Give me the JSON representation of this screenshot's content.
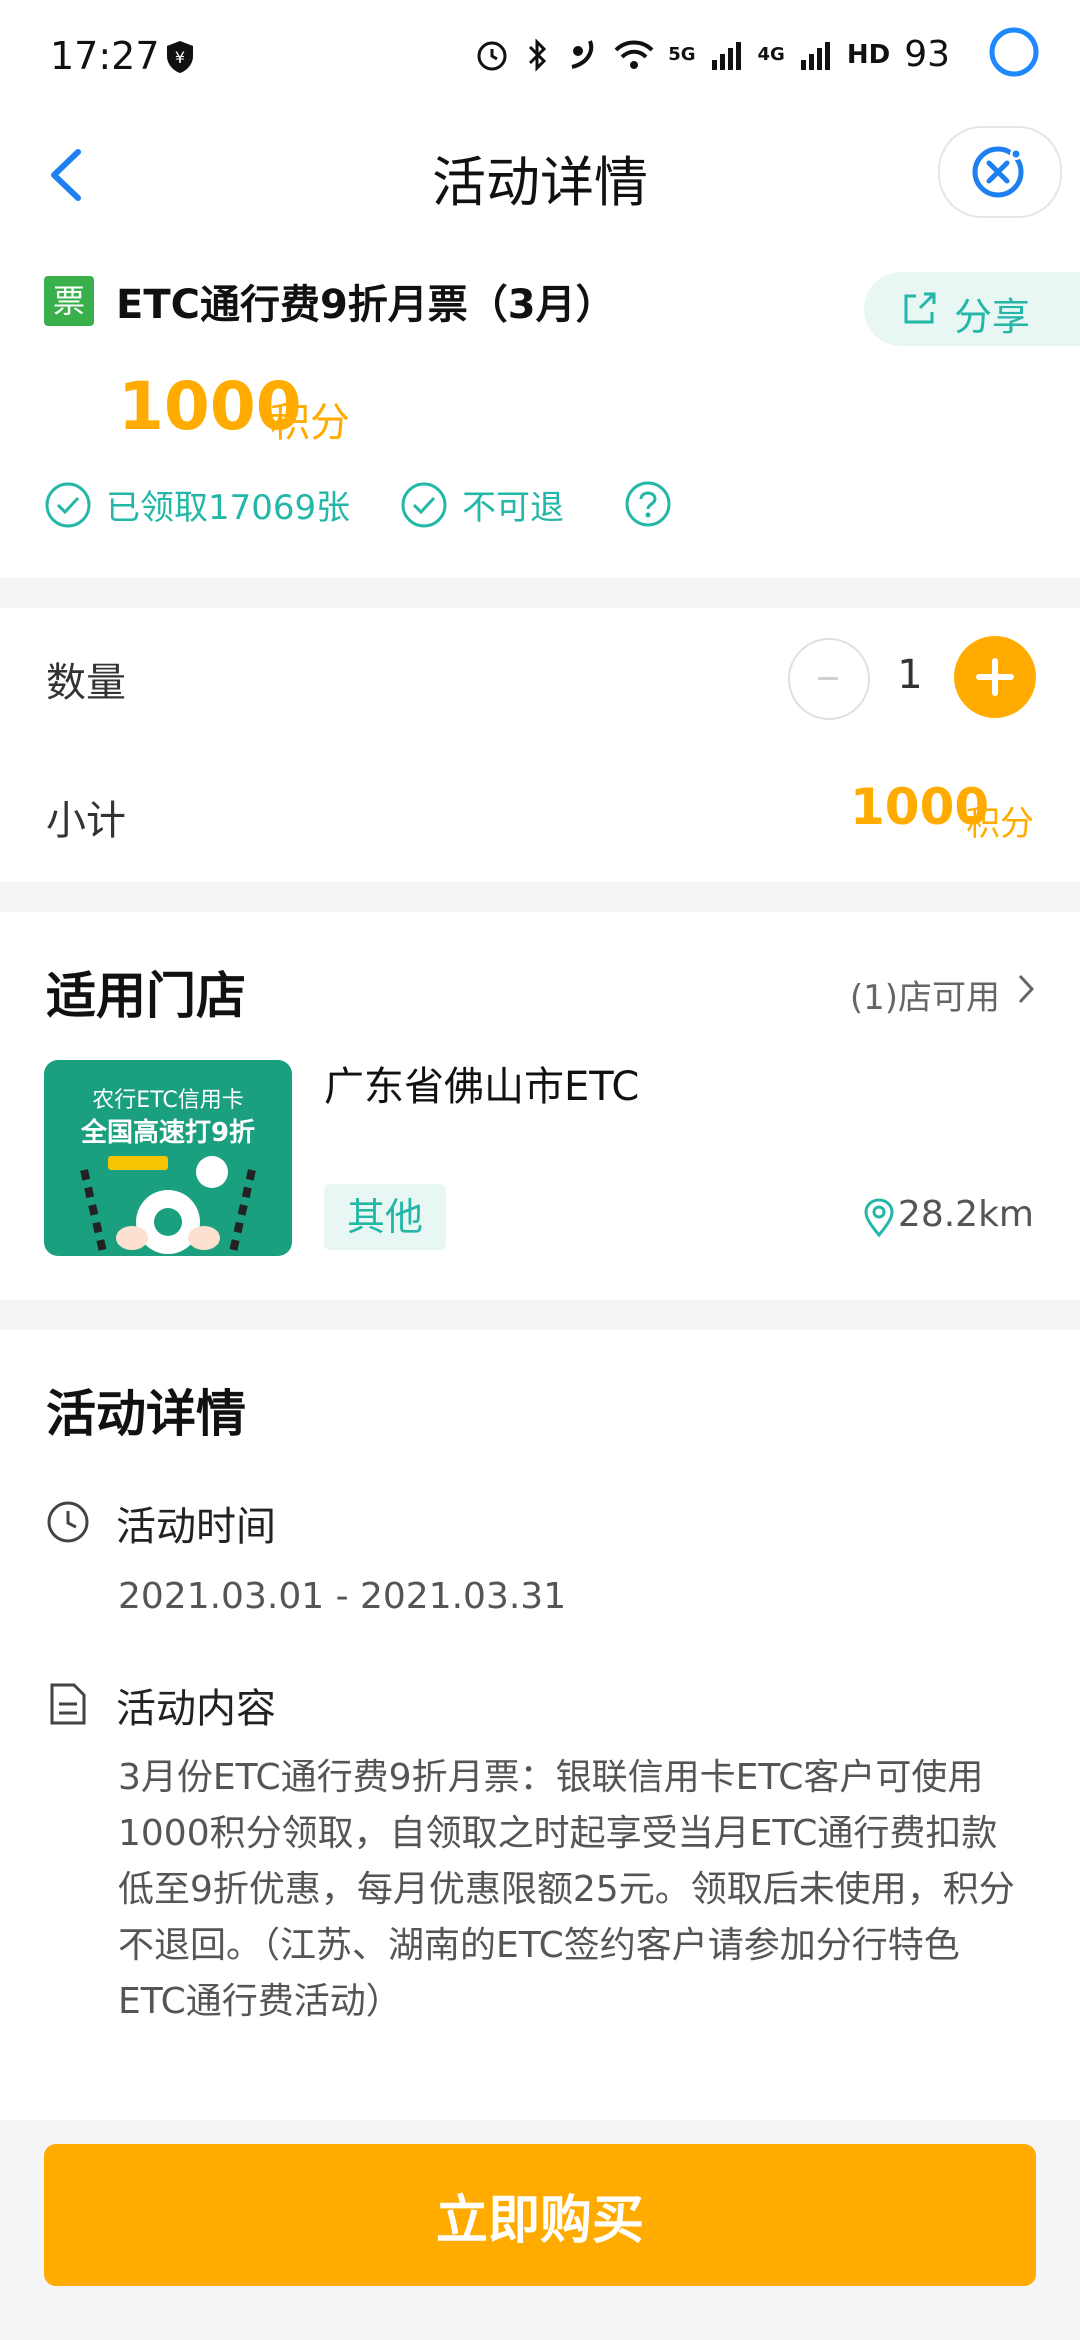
{
  "status_bar": {
    "time": "17:27",
    "battery": "93",
    "signal_5g": "5G",
    "signal_4g": "4G",
    "hd_label": "HD"
  },
  "header": {
    "title": "活动详情"
  },
  "product": {
    "badge": "票",
    "title": "ETC通行费9折月票（3月）",
    "share_label": "分享",
    "price": "1000",
    "price_unit": "积分",
    "tags": [
      "已领取17069张",
      "不可退"
    ]
  },
  "quantity": {
    "label": "数量",
    "value": "1",
    "subtotal_label": "小计",
    "subtotal_value": "1000",
    "subtotal_unit": "积分"
  },
  "stores": {
    "title": "适用门店",
    "count": "(1)店可用",
    "store": {
      "image_line1": "农行ETC信用卡",
      "image_line2": "全国高速打9折",
      "name": "广东省佛山市ETC",
      "tag": "其他",
      "distance": "28.2km"
    }
  },
  "details": {
    "title": "活动详情",
    "time_label": "活动时间",
    "time_value": "2021.03.01 - 2021.03.31",
    "content_label": "活动内容",
    "content_value": "3月份ETC通行费9折月票：银联信用卡ETC客户可使用1000积分领取，自领取之时起享受当月ETC通行费扣款低至9折优惠，每月优惠限额25元。领取后未使用，积分不退回。（江苏、湖南的ETC签约客户请参加分行特色ETC通行费活动）"
  },
  "bottom": {
    "buy_label": "立即购买"
  },
  "colors": {
    "accent": "#ffab00",
    "teal": "#24b7a7",
    "badge_green": "#3ab04d"
  }
}
